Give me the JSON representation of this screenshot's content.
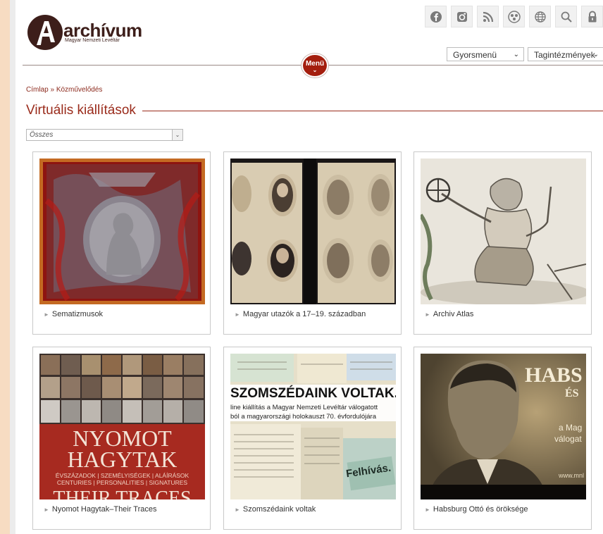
{
  "brand": {
    "name": "archívum",
    "subtitle": "Magyar Nemzeti Levéltár"
  },
  "top_icons": [
    "facebook-icon",
    "instagram-icon",
    "rss-icon",
    "flickr-icon",
    "globe-icon",
    "search-icon",
    "lock-icon"
  ],
  "quick_menu": {
    "label": "Gyorsmenü"
  },
  "institutions_menu": {
    "label": "Tagintézmények"
  },
  "menu_button": {
    "label": "Menü"
  },
  "breadcrumb": {
    "home": "Címlap",
    "separator": "»",
    "current": "Közművelődés"
  },
  "page_title": "Virtuális kiállítások",
  "filter": {
    "selected": "Összes"
  },
  "cards": [
    {
      "caption": "Sematizmusok"
    },
    {
      "caption": "Magyar utazók a 17–19. században"
    },
    {
      "caption": "Archiv Atlas"
    },
    {
      "caption": "Nyomot Hagytak–Their Traces",
      "image_text": {
        "line1": "NYOMOT",
        "line2": "HAGYTAK",
        "line3": "ÉVSZÁZADOK | SZEMÉLYISÉGEK | ALÁÍRÁSOK",
        "line4": "CENTURIES | PERSONALITIES | SIGNATURES",
        "line5": "THEIR TRACES"
      }
    },
    {
      "caption": "Szomszédaink voltak",
      "image_text": {
        "headline": "SZOMSZÉDAINK VOLTAK...",
        "sub1": "line kiállítás a Magyar Nemzeti Levéltár válogatott",
        "sub2": "ból a magyarországi holokauszt 70. évfordulójára",
        "stamp": "Felhívás."
      }
    },
    {
      "caption": "Habsburg Ottó és öröksége",
      "image_text": {
        "big": "HABS",
        "es": "ÉS",
        "a": "a Mag",
        "b": "válogat",
        "c": "www.mnl"
      }
    }
  ],
  "colors": {
    "accent": "#a41e0e",
    "brand_dark": "#3d1e1a",
    "title": "#9a2b1b",
    "background": "#f7dcc2"
  }
}
